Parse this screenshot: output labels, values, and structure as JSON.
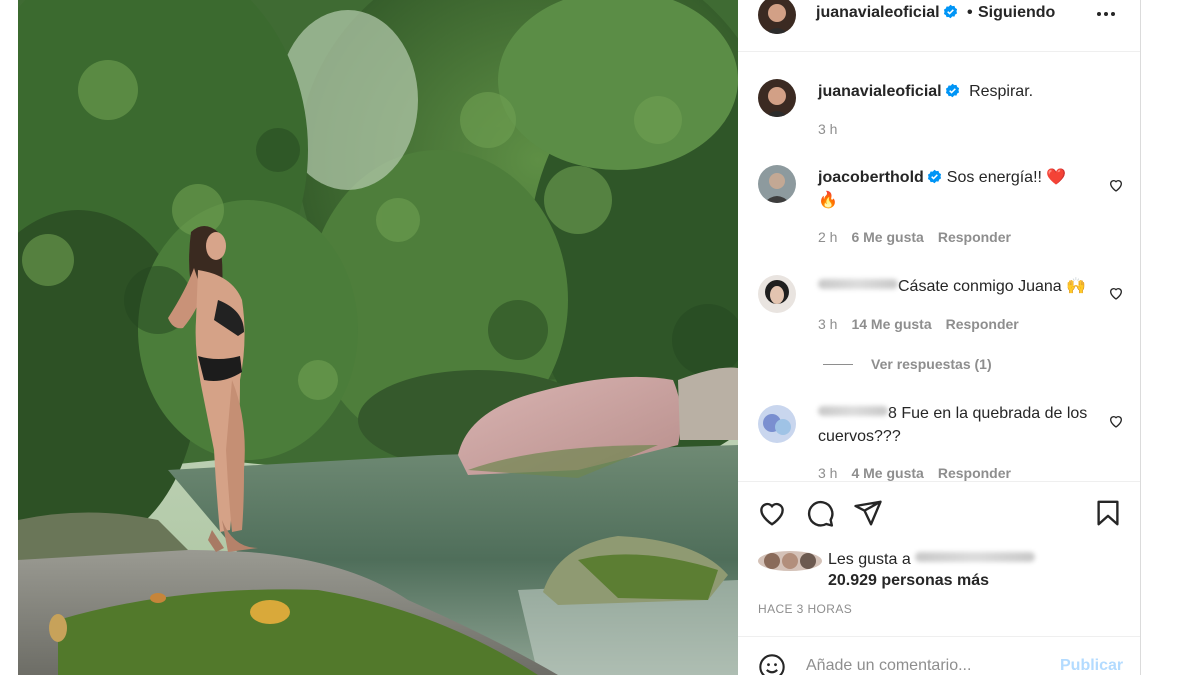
{
  "post": {
    "author": "juanavialeoficial",
    "follow_status": "Siguiendo",
    "separator": "•"
  },
  "caption": {
    "username": "juanavialeoficial",
    "text": "Respirar.",
    "time": "3 h"
  },
  "comments": [
    {
      "username": "joacoberthold",
      "text": "Sos energía!! ",
      "emoji": "❤️ 🔥",
      "time": "2 h",
      "likes": "6 Me gusta",
      "reply": "Responder"
    },
    {
      "username_hidden": true,
      "text": "Cásate conmigo Juana",
      "emoji": "🙌",
      "time": "3 h",
      "likes": "14 Me gusta",
      "reply": "Responder",
      "view_replies": "Ver respuestas (1)"
    },
    {
      "username_hidden": true,
      "username_suffix": "8",
      "text": "Fue en la quebrada de los cuervos???",
      "time": "3 h",
      "likes": "4 Me gusta",
      "reply": "Responder"
    }
  ],
  "likes": {
    "prefix": "Les gusta a",
    "count_text": "20.929 personas más"
  },
  "timestamp": "HACE 3 HORAS",
  "add_comment": {
    "placeholder": "Añade un comentario...",
    "publish": "Publicar"
  },
  "colors": {
    "verified": "#0095f6",
    "publish_disabled": "#b3dbff",
    "secondary_text": "#8e8e8e",
    "heart": "#ed4956"
  },
  "icons": [
    "more-icon",
    "verified-icon",
    "heart-icon",
    "comment-icon",
    "share-icon",
    "bookmark-icon",
    "emoji-icon"
  ]
}
